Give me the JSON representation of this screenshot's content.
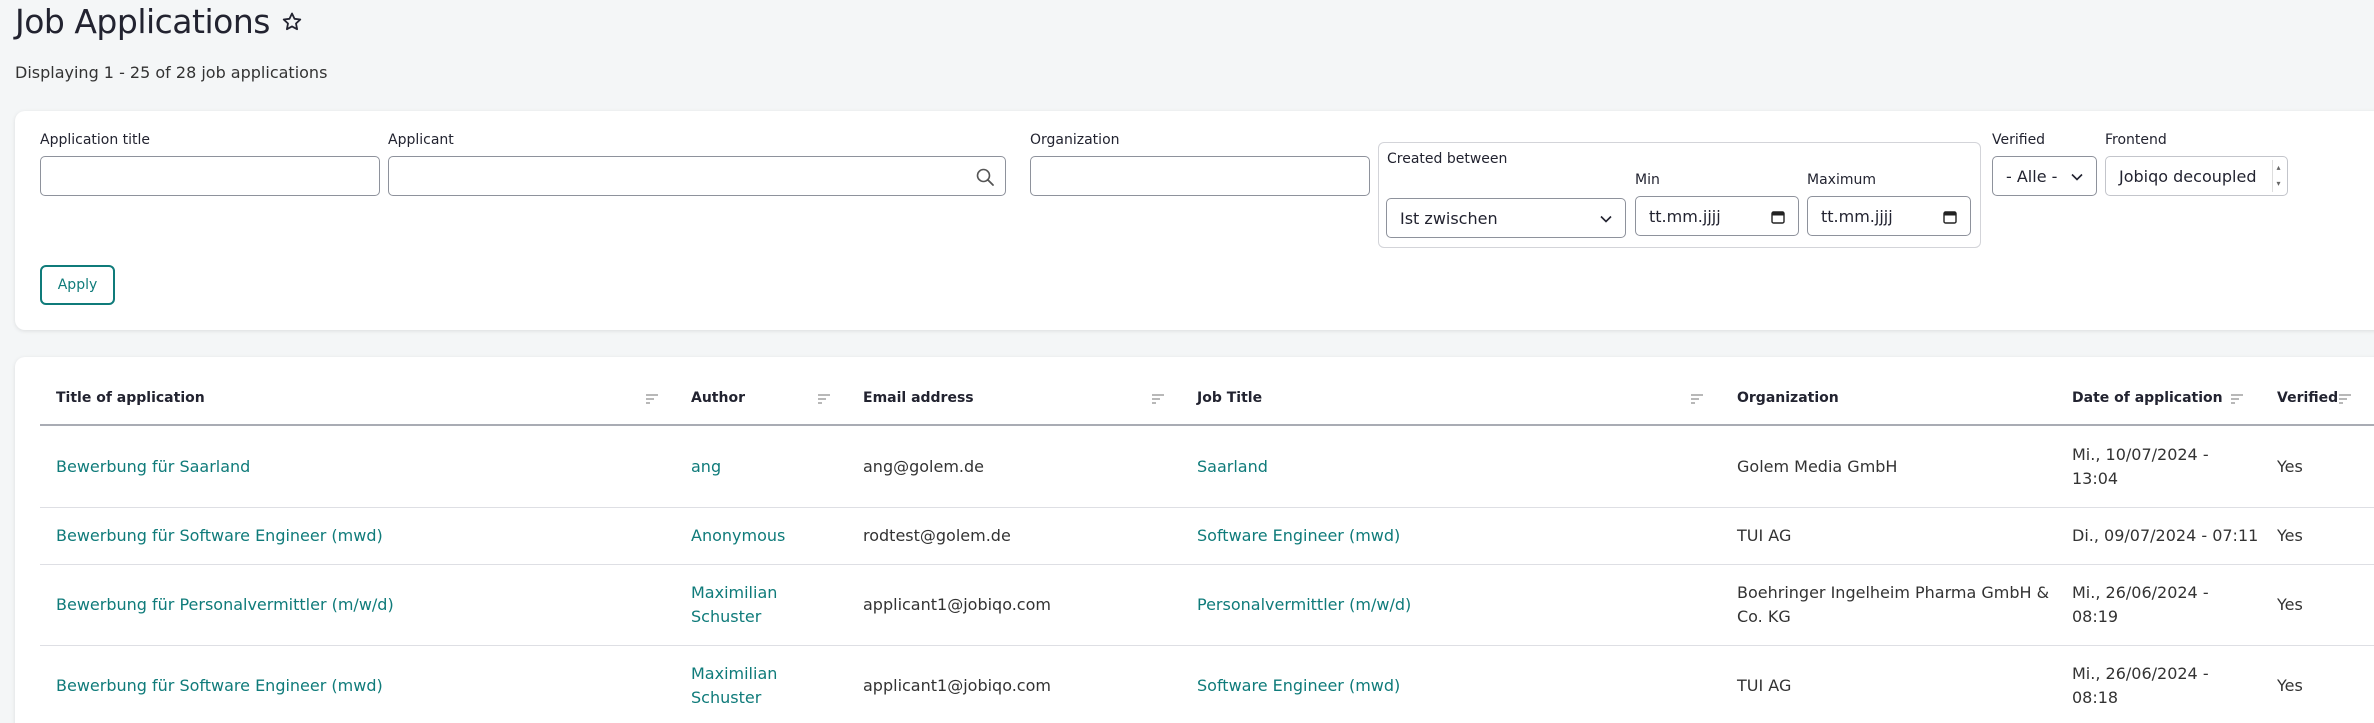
{
  "header": {
    "title": "Job Applications",
    "summary": "Displaying 1 - 25 of 28 job applications"
  },
  "filters": {
    "application_title": {
      "label": "Application title",
      "value": ""
    },
    "applicant": {
      "label": "Applicant",
      "value": ""
    },
    "organization": {
      "label": "Organization",
      "value": ""
    },
    "created_between": {
      "legend": "Created between",
      "operator": "Ist zwischen",
      "min_label": "Min",
      "min_placeholder": "tt.mm.jjjj",
      "max_label": "Maximum",
      "max_placeholder": "tt.mm.jjjj"
    },
    "verified": {
      "label": "Verified",
      "value": "- Alle -"
    },
    "frontend": {
      "label": "Frontend",
      "value": "Jobiqo decoupled"
    },
    "apply_label": "Apply"
  },
  "table": {
    "columns": [
      "Title of application",
      "Author",
      "Email address",
      "Job Title",
      "Organization",
      "Date of application",
      "Verified"
    ],
    "rows": [
      {
        "title": "Bewerbung für Saarland",
        "author": "ang",
        "email": "ang@golem.de",
        "job_title": "Saarland",
        "organization": "Golem Media GmbH",
        "date_line1": "Mi., 10/07/2024 -",
        "date_line2": "13:04",
        "verified": "Yes"
      },
      {
        "title": "Bewerbung für Software Engineer (mwd)",
        "author": "Anonymous",
        "email": "rodtest@golem.de",
        "job_title": "Software Engineer (mwd)",
        "organization": "TUI AG",
        "date_line1": "Di., 09/07/2024 - 07:11",
        "date_line2": "",
        "verified": "Yes"
      },
      {
        "title": "Bewerbung für Personalvermittler (m/w/d)",
        "author_line1": "Maximilian",
        "author_line2": "Schuster",
        "email": "applicant1@jobiqo.com",
        "job_title": "Personalvermittler (m/w/d)",
        "org_line1": "Boehringer Ingelheim Pharma GmbH &",
        "org_line2": "Co. KG",
        "date_line1": "Mi., 26/06/2024 -",
        "date_line2": "08:19",
        "verified": "Yes"
      },
      {
        "title": "Bewerbung für Software Engineer (mwd)",
        "author_line1": "Maximilian",
        "author_line2": "Schuster",
        "email": "applicant1@jobiqo.com",
        "job_title": "Software Engineer (mwd)",
        "organization": "TUI AG",
        "date_line1": "Mi., 26/06/2024 -",
        "date_line2": "08:18",
        "verified": "Yes"
      }
    ]
  },
  "icons": {
    "favorite": "star-outline-icon",
    "search": "search-icon",
    "dropdown": "chevron-down-icon",
    "calendar": "calendar-icon",
    "sort": "sort-icon"
  },
  "colors": {
    "accent": "#0f7b7a",
    "text": "#222330",
    "background": "#f4f6f7"
  }
}
